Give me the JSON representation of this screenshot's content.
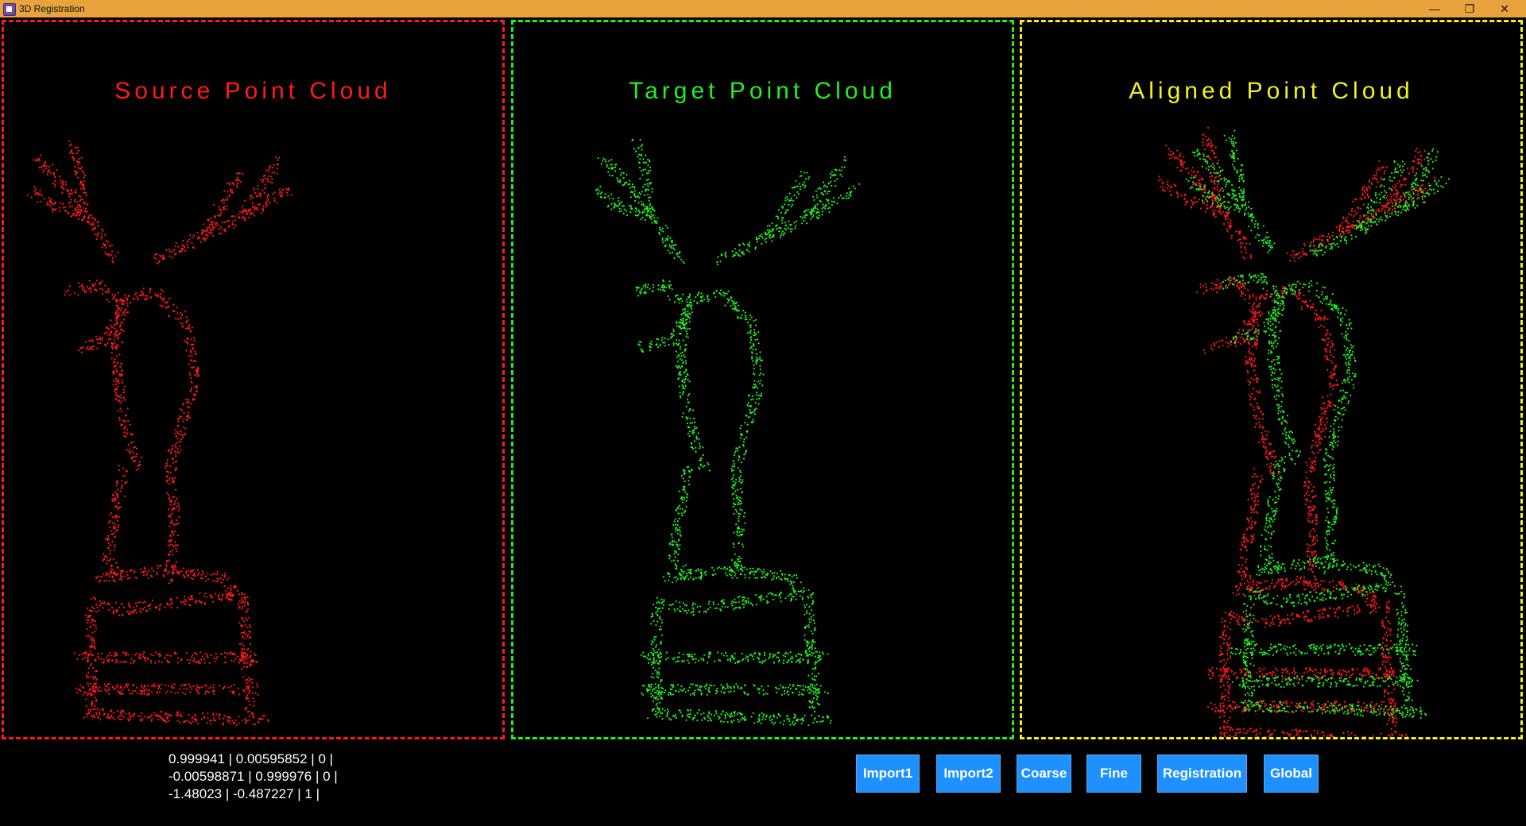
{
  "window": {
    "title": "3D Registration",
    "icons": [
      "app-icon",
      "minimize-icon",
      "restore-icon",
      "close-icon"
    ],
    "minimize_glyph": "—",
    "restore_glyph": "❐",
    "close_glyph": "✕"
  },
  "panels": [
    {
      "title": "Source Point Cloud",
      "color": "#ff1a1a"
    },
    {
      "title": "Target Point Cloud",
      "color": "#22ee22"
    },
    {
      "title": "Aligned Point Cloud",
      "color": "#f2f21a"
    }
  ],
  "matrix": {
    "rows": [
      "0.999941 | 0.00595852 | 0 |",
      "-0.00598871 | 0.999976 | 0 |",
      "-1.48023 | -0.487227 | 1 |"
    ]
  },
  "buttons": {
    "import1": "Import1",
    "import2": "Import2",
    "coarse": "Coarse",
    "fine": "Fine",
    "registration": "Registration",
    "global": "Global"
  },
  "colors": {
    "title_bar": "#e8a33c",
    "button": "#1e90ff",
    "source_points": "#ff1a1a",
    "target_points": "#22ee22",
    "aligned_border": "#f2f21a"
  }
}
